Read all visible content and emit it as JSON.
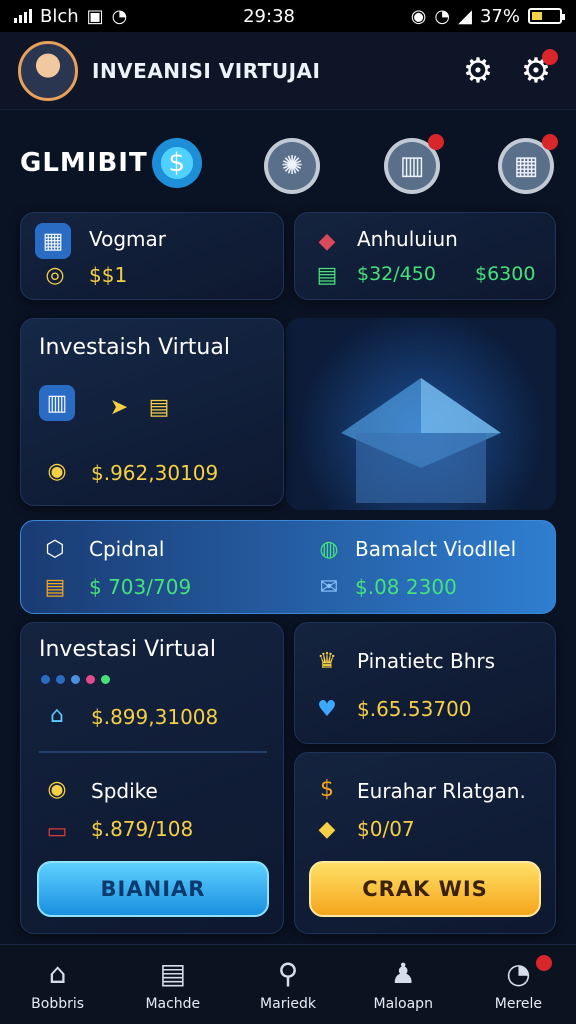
{
  "status_bar": {
    "carrier": "Blch",
    "time": "29:38",
    "battery": "37%",
    "battery_level": 0.37
  },
  "header": {
    "title": "INVEANISI VIRTUJAI"
  },
  "shortcuts": {
    "brand": "GLMIBIT"
  },
  "cards": {
    "top_left": {
      "title": "Vogmar",
      "value": "$$1"
    },
    "top_right": {
      "title": "Anhuluiun",
      "value": "$32/450",
      "value2": "$6300"
    },
    "hero": {
      "title": "Investaish Virtual",
      "value": "$.962,30109"
    },
    "banner_left": {
      "title": "Cpidnal",
      "value": "$ 703/709"
    },
    "banner_right": {
      "title": "Bamalct Viodllel",
      "value": "$.08 2300"
    },
    "mid_left": {
      "title": "Investasi Virtual",
      "value": "$.899,31008"
    },
    "mid_right": {
      "title": "Pinatietc Bhrs",
      "value": "$.65.53700"
    },
    "low_left": {
      "title": "Spdike",
      "value": "$.879/108",
      "button": "BIANIAR"
    },
    "low_right": {
      "title": "Eurahar Rlatgan.",
      "value": "$0/07",
      "button": "CRAK WIS"
    }
  },
  "nav": [
    {
      "label": "Bobbris",
      "icon": "home-icon"
    },
    {
      "label": "Machde",
      "icon": "list-icon"
    },
    {
      "label": "Mariedk",
      "icon": "search-icon"
    },
    {
      "label": "Maloapn",
      "icon": "user-icon"
    },
    {
      "label": "Merele",
      "icon": "profile-icon"
    }
  ],
  "colors": {
    "accent_blue": "#2f7ed0",
    "gold": "#f5cf45",
    "green": "#45e27a",
    "badge_red": "#d8262b"
  }
}
